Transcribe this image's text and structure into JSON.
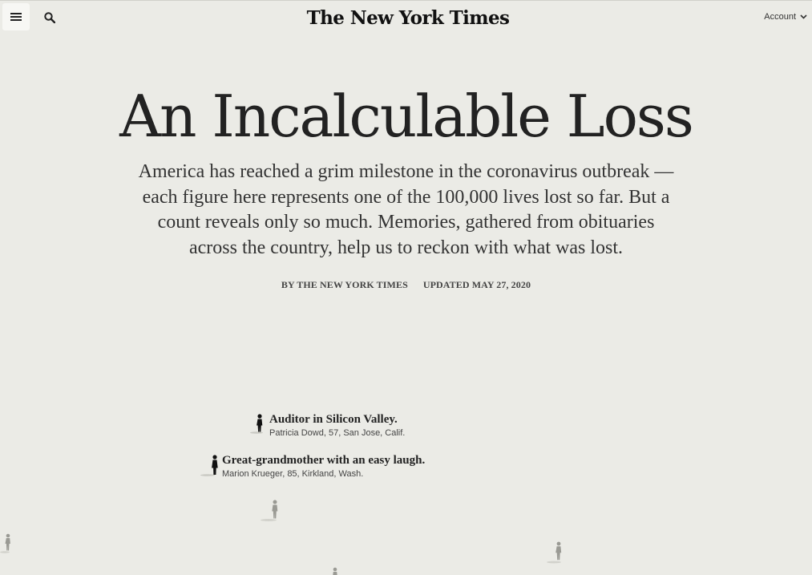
{
  "header": {
    "masthead": "The New York Times",
    "account_label": "Account"
  },
  "article": {
    "headline": "An Incalculable Loss",
    "dek": "America has reached a grim milestone in the coronavirus outbreak — each figure here represents one of the 100,000 lives lost so far. But a count reveals only so much. Memories, gathered from obituaries across the country, help us to reckon with what was lost.",
    "byline": "BY THE NEW YORK TIMES",
    "updated": "UPDATED MAY 27, 2020"
  },
  "memorials": [
    {
      "title": "Auditor in Silicon Valley.",
      "subtitle": "Patricia Dowd, 57, San Jose, Calif."
    },
    {
      "title": "Great-grandmother with an easy laugh.",
      "subtitle": "Marion Krueger, 85, Kirkland, Wash."
    }
  ],
  "colors": {
    "background": "#ebebe6",
    "figure_active": "#111111",
    "figure_faded": "#9a9a94"
  },
  "icons": {
    "menu": "hamburger-menu-icon",
    "search": "search-icon",
    "account_chevron": "chevron-down-icon",
    "figure": "person-figure-icon"
  }
}
